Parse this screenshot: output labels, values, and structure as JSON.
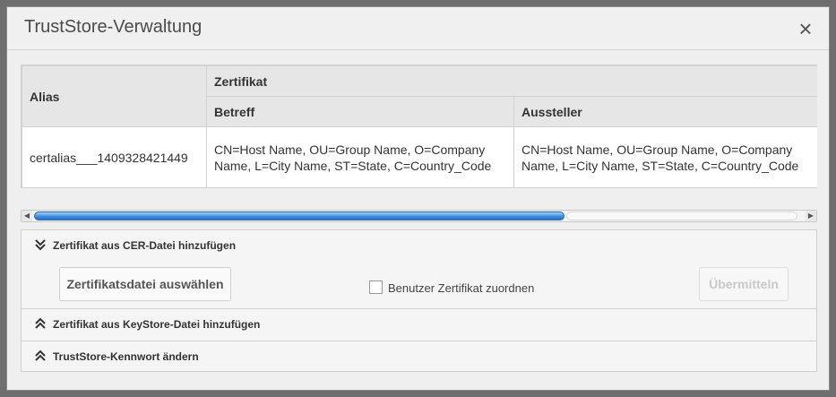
{
  "dialog": {
    "title": "TrustStore-Verwaltung",
    "close_icon": "×"
  },
  "table": {
    "headers": {
      "alias": "Alias",
      "certificate": "Zertifikat",
      "subject": "Betreff",
      "issuer": "Aussteller"
    },
    "rows": [
      {
        "alias": "certalias___1409328421449",
        "subject_line1": "CN=Host Name, OU=Group Name, O=Company",
        "subject_line2": "Name, L=City Name, ST=State, C=Country_Code",
        "issuer_line1": "CN=Host Name, OU=Group Name, O=Company",
        "issuer_line2": "Name, L=City Name, ST=State, C=Country_Code"
      }
    ]
  },
  "sections": [
    {
      "label": "Zertifikat aus CER-Datei hinzufügen",
      "state": "expanded",
      "select_file_button": "Zertifikatsdatei auswählen",
      "checkbox_label": "Benutzer Zertifikat zuordnen",
      "checkbox_checked": false,
      "submit_button": "Übermitteln",
      "submit_enabled": false
    },
    {
      "label": "Zertifikat aus KeyStore-Datei hinzufügen",
      "state": "collapsed"
    },
    {
      "label": "TrustStore-Kennwort ändern",
      "state": "collapsed"
    }
  ],
  "colors": {
    "scroll_thumb": "#3f8ee0",
    "header_bg": "#e6e6e6"
  },
  "icons": {
    "expanded": "chevron-double-down-icon",
    "collapsed": "chevron-double-up-icon"
  }
}
